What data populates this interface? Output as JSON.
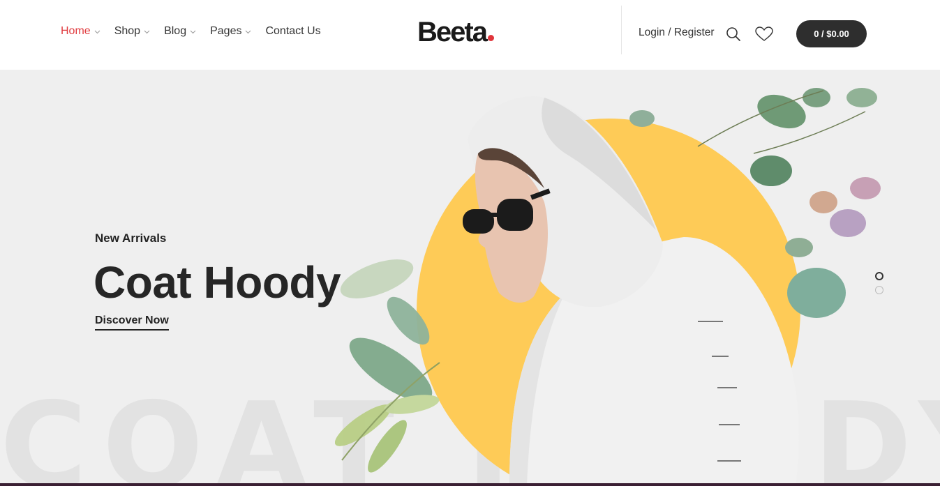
{
  "nav": {
    "items": [
      {
        "label": "Home",
        "active": true,
        "has_dropdown": true
      },
      {
        "label": "Shop",
        "active": false,
        "has_dropdown": true
      },
      {
        "label": "Blog",
        "active": false,
        "has_dropdown": true
      },
      {
        "label": "Pages",
        "active": false,
        "has_dropdown": true
      },
      {
        "label": "Contact Us",
        "active": false,
        "has_dropdown": false
      }
    ]
  },
  "logo": {
    "text": "Beeta",
    "dot_color": "#e0353b"
  },
  "header": {
    "login_label": "Login / Register",
    "search_icon": "search-icon",
    "wishlist_icon": "heart-icon",
    "cart_label": "0 / $0.00"
  },
  "hero": {
    "subtitle": "New Arrivals",
    "title": "Coat Hoody",
    "cta_label": "Discover Now",
    "watermark": "COAT HOODY",
    "circle_color": "#fecb57",
    "background": "#efefef",
    "slides": 2,
    "active_slide": 1
  },
  "colors": {
    "accent": "#e03a3e",
    "dark": "#2e2e2e"
  }
}
